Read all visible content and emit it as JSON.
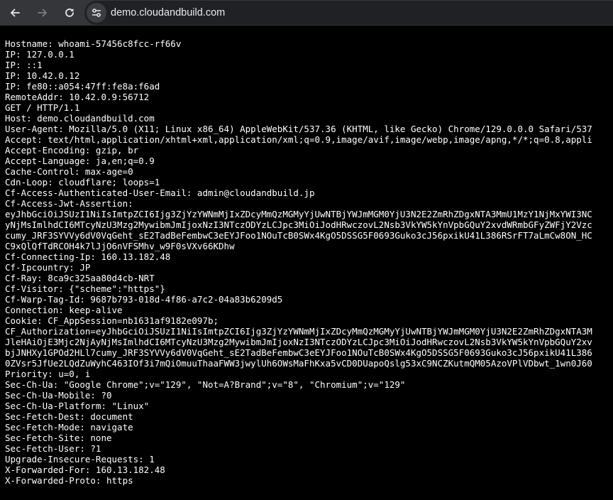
{
  "browser": {
    "url": "demo.cloudandbuild.com"
  },
  "icons": {
    "back": "arrow-left-icon",
    "forward": "arrow-right-icon",
    "reload": "reload-icon",
    "site_info": "tune-icon"
  },
  "colors": {
    "toolbar_bg": "#35363a",
    "omnibox_bg": "#202124",
    "page_bg": "#000000",
    "page_text": "#ffffff",
    "forward_disabled": "#7b7c80"
  },
  "lines": [
    "Hostname: whoami-57456c8fcc-rf66v",
    "IP: 127.0.0.1",
    "IP: ::1",
    "IP: 10.42.0.12",
    "IP: fe80::a054:47ff:fe8a:f6ad",
    "RemoteAddr: 10.42.0.9:56712",
    "GET / HTTP/1.1",
    "Host: demo.cloudandbuild.com",
    "User-Agent: Mozilla/5.0 (X11; Linux x86_64) AppleWebKit/537.36 (KHTML, like Gecko) Chrome/129.0.0.0 Safari/537",
    "Accept: text/html,application/xhtml+xml,application/xml;q=0.9,image/avif,image/webp,image/apng,*/*;q=0.8,appli",
    "Accept-Encoding: gzip, br",
    "Accept-Language: ja,en;q=0.9",
    "Cache-Control: max-age=0",
    "Cdn-Loop: cloudflare; loops=1",
    "Cf-Access-Authenticated-User-Email: admin@cloudandbuild.jp",
    "Cf-Access-Jwt-Assertion:",
    "eyJhbGciOiJSUzI1NiIsImtpZCI6Ijg3ZjYzYWNmMjIxZDcyMmQzMGMyYjUwNTBjYWJmMGM0YjU3N2E2ZmRhZDgxNTA3MmU1MzY1NjMxYWI3NC",
    "yNjMsImlhdCI6MTcyNzU3Mzg2MywibmJmIjoxNzI3NTczODYzLCJpc3MiOiJodHRwczovL2Nsb3VkYW5kYnVpbGQuY2xvdWRmbGFyZWFjY2Vzc",
    "cumy_JRF3SYVVy6dV0VqGeht_sE2TadBeFembwC3eEYJFoo1NOuTcB0SWx4KgO5DSSG5F0693Guko3cJ56pxikU41L386RSrFT7aLmCw8ON_HC",
    "C9xQlQfTdRCOH4k7lJjO6nVFSMhv_w9F0sVXv66KDhw",
    "Cf-Connecting-Ip: 160.13.182.48",
    "Cf-Ipcountry: JP",
    "Cf-Ray: 8ca9c325aa80d4cb-NRT",
    "Cf-Visitor: {\"scheme\":\"https\"}",
    "Cf-Warp-Tag-Id: 9687b793-018d-4f86-a7c2-04a83b6209d5",
    "Connection: keep-alive",
    "Cookie: CF_AppSession=nb1631af9182e097b;",
    "CF_Authorization=eyJhbGciOiJSUzI1NiIsImtpZCI6Ijg3ZjYzYWNmMjIxZDcyMmQzMGMyYjUwNTBjYWJmMGM0YjU3N2E2ZmRhZDgxNTA3M",
    "JleHAiOjE3Mjc2NjAyNjMsImlhdCI6MTcyNzU3Mzg2MywibmJmIjoxNzI3NTczODYzLCJpc3MiOiJodHRwczovL2Nsb3VkYW5kYnVpbGQuY2xv",
    "bjJNHXy1GPOd2HLl7cumy_JRF3SYVVy6dV0VqGeht_sE2TadBeFembwC3eEYJFoo1NOuTcB0SWx4KgO5DSSG5F0693Guko3cJ56pxikU41L386",
    "0ZVsr5JfUe2LQdZuWyhC463IOf3i7mQiOmuuThaaFWW3jwylUh6OWsMaFhKxa5vCD0DUapoQslg53xC9NCZKutmQM05AzoVPlVDbwt_1wn0J60",
    "Priority: u=0, i",
    "Sec-Ch-Ua: \"Google Chrome\";v=\"129\", \"Not=A?Brand\";v=\"8\", \"Chromium\";v=\"129\"",
    "Sec-Ch-Ua-Mobile: ?0",
    "Sec-Ch-Ua-Platform: \"Linux\"",
    "Sec-Fetch-Dest: document",
    "Sec-Fetch-Mode: navigate",
    "Sec-Fetch-Site: none",
    "Sec-Fetch-User: ?1",
    "Upgrade-Insecure-Requests: 1",
    "X-Forwarded-For: 160.13.182.48",
    "X-Forwarded-Proto: https"
  ]
}
